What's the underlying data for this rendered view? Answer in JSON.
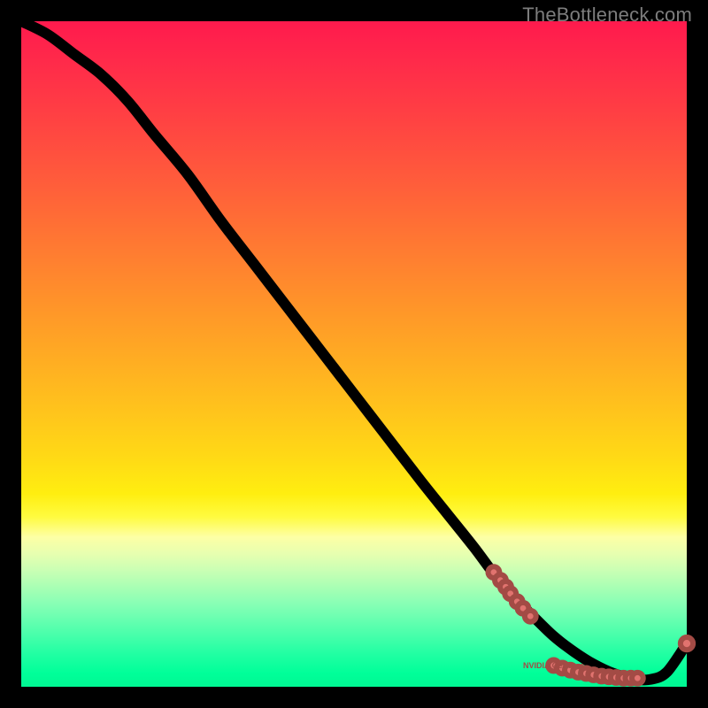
{
  "watermark": "TheBottleneck.com",
  "colors": {
    "dot_fill": "#e1736f",
    "dot_stroke": "#a34b45",
    "curve": "#000000"
  },
  "chart_data": {
    "type": "line",
    "title": "",
    "xlabel": "",
    "ylabel": "",
    "xlim": [
      0,
      100
    ],
    "ylim": [
      0,
      100
    ],
    "grid": false,
    "annotations": [
      {
        "text": "NVIDIA GeForce",
        "x": 80,
        "y": 3
      }
    ],
    "series": [
      {
        "name": "bottleneck-curve",
        "x": [
          0,
          4,
          8,
          12,
          16,
          20,
          25,
          30,
          35,
          40,
          45,
          50,
          55,
          60,
          64,
          68,
          71,
          74,
          77,
          80,
          83,
          86,
          89,
          92,
          94.5,
          97,
          100
        ],
        "y": [
          100,
          98,
          95,
          92,
          88,
          83,
          77,
          70,
          63.5,
          57,
          50.5,
          44,
          37.5,
          31,
          26,
          21,
          17,
          13.5,
          10.5,
          7.6,
          5.3,
          3.4,
          2.0,
          1.2,
          1.1,
          2.2,
          6.5
        ]
      }
    ],
    "marker_clusters": [
      {
        "name": "upper-descending-cluster",
        "points": [
          {
            "x": 71.0,
            "y": 17.2
          },
          {
            "x": 72.0,
            "y": 16.0
          },
          {
            "x": 72.8,
            "y": 15.0
          },
          {
            "x": 73.5,
            "y": 14.0
          },
          {
            "x": 74.5,
            "y": 12.8
          },
          {
            "x": 75.4,
            "y": 11.8
          },
          {
            "x": 76.5,
            "y": 10.6
          }
        ]
      },
      {
        "name": "valley-cluster",
        "points": [
          {
            "x": 80.0,
            "y": 3.2
          },
          {
            "x": 81.3,
            "y": 2.8
          },
          {
            "x": 82.5,
            "y": 2.5
          },
          {
            "x": 83.7,
            "y": 2.2
          },
          {
            "x": 84.9,
            "y": 2.0
          },
          {
            "x": 86.0,
            "y": 1.8
          },
          {
            "x": 87.2,
            "y": 1.6
          },
          {
            "x": 88.3,
            "y": 1.5
          },
          {
            "x": 89.4,
            "y": 1.4
          },
          {
            "x": 90.5,
            "y": 1.3
          },
          {
            "x": 91.6,
            "y": 1.3
          },
          {
            "x": 92.6,
            "y": 1.3
          }
        ]
      },
      {
        "name": "tail-point",
        "points": [
          {
            "x": 100.0,
            "y": 6.5
          }
        ]
      }
    ]
  }
}
